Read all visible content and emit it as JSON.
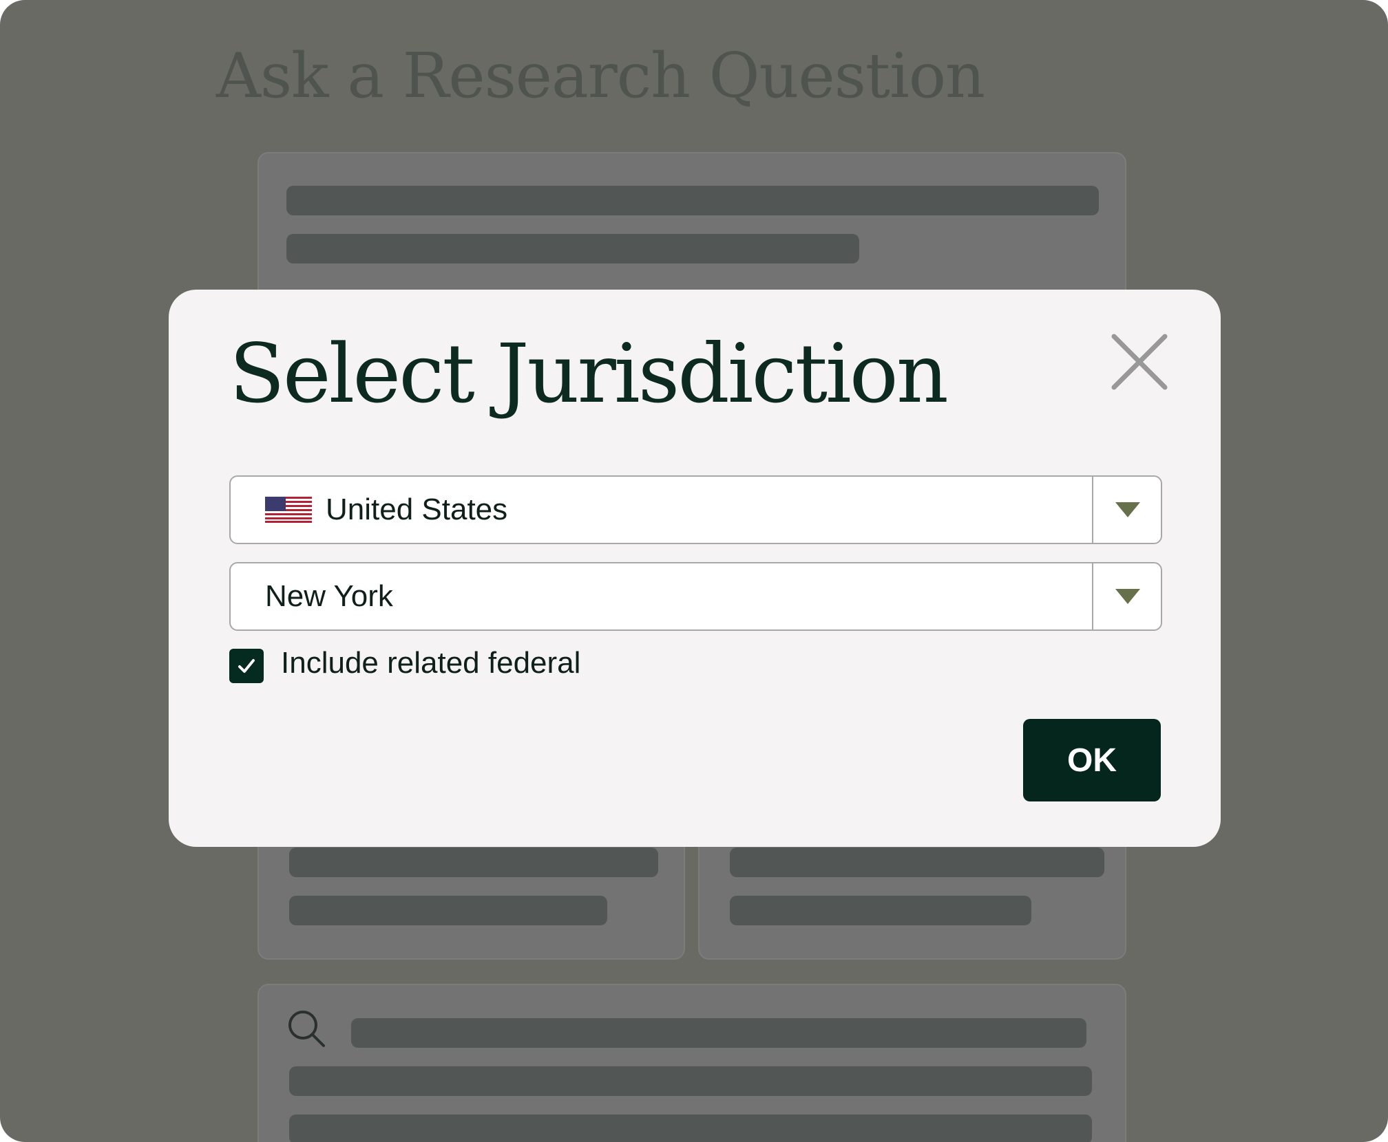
{
  "background": {
    "page_title": "Ask a Research Question"
  },
  "modal": {
    "title": "Select Jurisdiction",
    "country_select": {
      "value": "United States",
      "flag": "us-flag-icon"
    },
    "region_select": {
      "value": "New York"
    },
    "checkbox": {
      "label": "Include related federal",
      "checked": true
    },
    "ok_button": "OK"
  },
  "colors": {
    "accent": "#04261d",
    "overlay": "#696a64",
    "dropdown_arrow": "#66704a"
  }
}
